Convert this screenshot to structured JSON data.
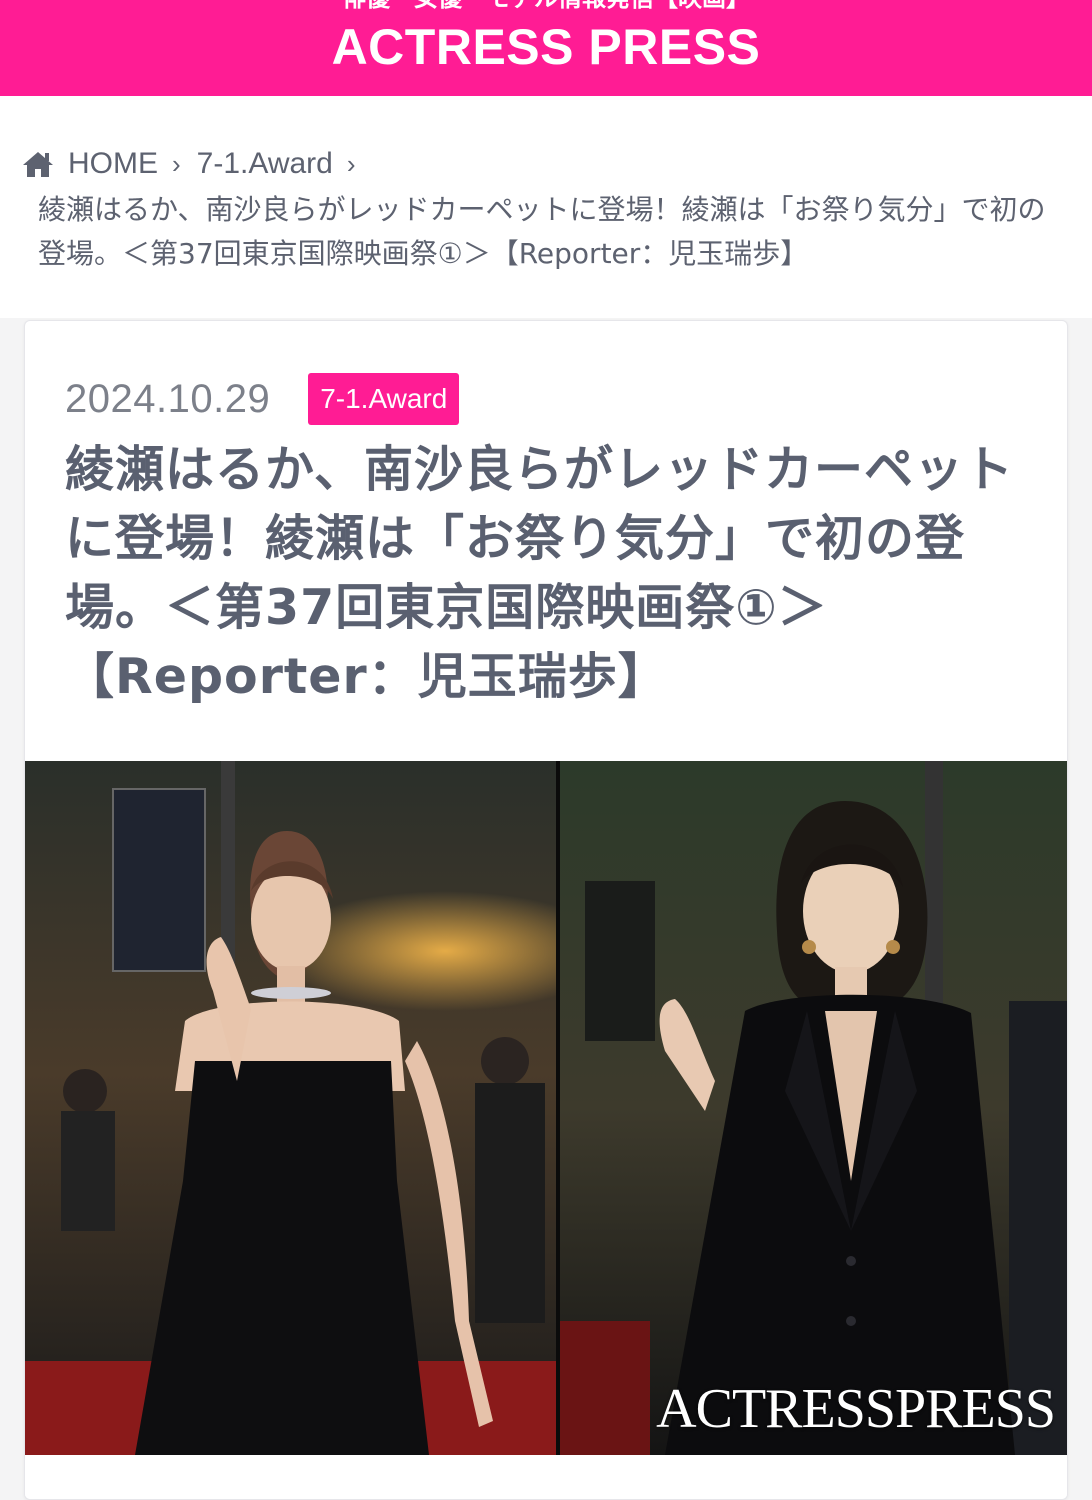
{
  "header": {
    "tagline": "俳優・女優・モデル情報発信【映画】",
    "site_title": "ACTRESS PRESS",
    "bg_color": "#ff1c94"
  },
  "breadcrumb": {
    "icon": "home-icon",
    "items": [
      "HOME",
      "7-1.Award"
    ],
    "current": "綾瀬はるか、南沙良らがレッドカーペットに登場！綾瀬は「お祭り気分」で初の登場。＜第37回東京国際映画祭①＞【Reporter：児玉瑞歩】"
  },
  "article": {
    "date": "2024.10.29",
    "category": "7-1.Award",
    "title": "綾瀬はるか、南沙良らがレッドカーペットに登場！綾瀬は「お祭り気分」で初の登場。＜第37回東京国際映画祭①＞【Reporter：児玉瑞歩】",
    "image_watermark": "ACTRESSPRESS",
    "accent_color": "#ff1c94"
  }
}
